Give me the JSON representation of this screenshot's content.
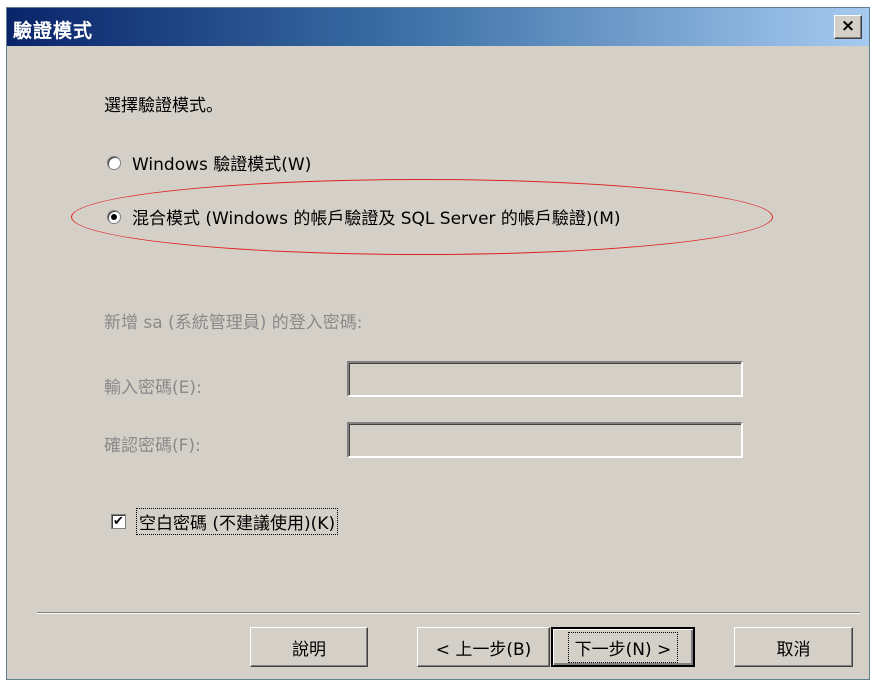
{
  "window": {
    "title": "驗證模式",
    "close_label": "×"
  },
  "prompt": "選擇驗證模式。",
  "auth_options": [
    {
      "label": "Windows 驗證模式(W)",
      "checked": false
    },
    {
      "label": "混合模式 (Windows 的帳戶驗證及 SQL Server 的帳戶驗證)(M)",
      "checked": true
    }
  ],
  "password_group": {
    "label": "新增 sa (系統管理員) 的登入密碼:",
    "enter_label": "輸入密碼(E):",
    "enter_value": "",
    "confirm_label": "確認密碼(F):",
    "confirm_value": ""
  },
  "blank_password": {
    "label": "空白密碼 (不建議使用)(K)",
    "checked": true,
    "check_glyph": "✔"
  },
  "buttons": {
    "help": "說明",
    "back": "< 上一步(B)",
    "next": "下一步(N) >",
    "cancel": "取消"
  },
  "colors": {
    "highlight_ellipse": "#e02020",
    "dialog_bg": "#d4d0c8",
    "title_bar": "#0a246a"
  }
}
